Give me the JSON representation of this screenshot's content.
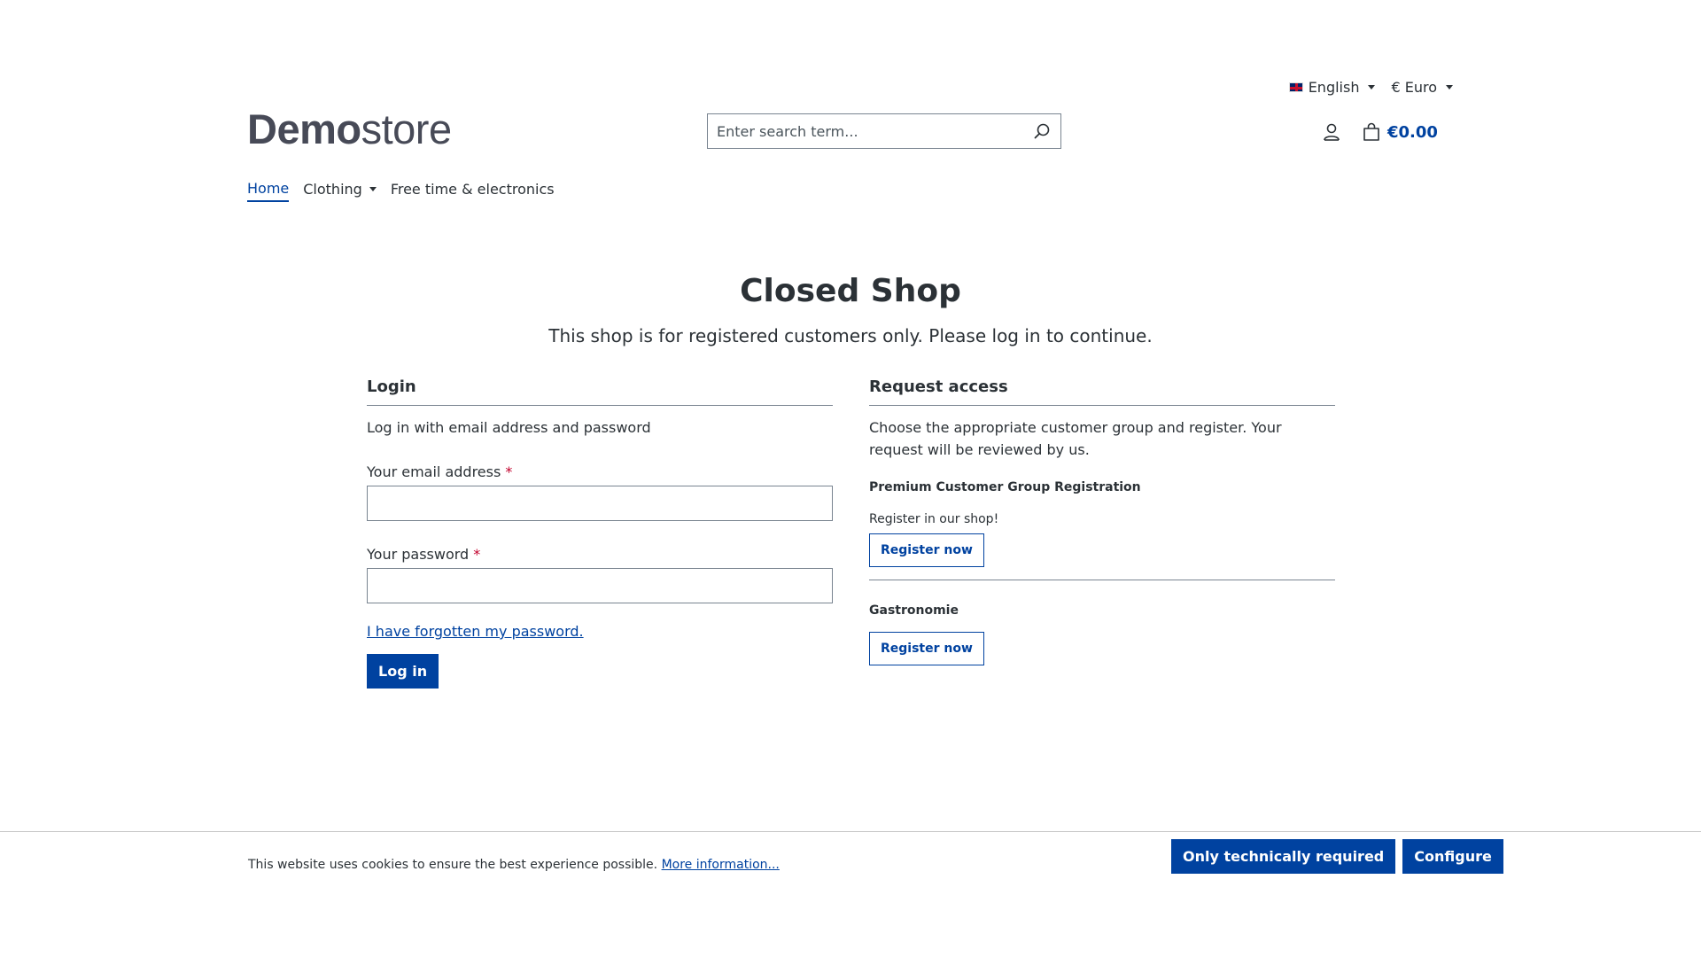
{
  "top_bar": {
    "language": {
      "label": "English",
      "icon": "uk-flag-icon"
    },
    "currency": {
      "label": "€ Euro"
    }
  },
  "header": {
    "logo_bold": "Demo",
    "logo_light": "store",
    "search_placeholder": "Enter search term...",
    "search_icon": "search-icon",
    "account_icon": "user-icon",
    "cart_icon": "shopping-bag-icon",
    "cart_total": "€0.00"
  },
  "nav": {
    "items": [
      {
        "label": "Home",
        "active": true
      },
      {
        "label": "Clothing",
        "has_dropdown": true
      },
      {
        "label": "Free time & electronics"
      }
    ]
  },
  "main": {
    "title": "Closed Shop",
    "subtitle": "This shop is for registered customers only. Please log in to continue."
  },
  "login": {
    "heading": "Login",
    "lead": "Log in with email address and password",
    "email_label": "Your email address",
    "password_label": "Your password",
    "required_marker": "*",
    "forgot_link": "I have forgotten my password.",
    "submit_label": "Log in"
  },
  "request_access": {
    "heading": "Request access",
    "lead": "Choose the appropriate customer group and register. Your request will be reviewed by us.",
    "groups": [
      {
        "title": "Premium Customer Group Registration",
        "description": "Register in our shop!",
        "button": "Register now"
      },
      {
        "title": "Gastronomie",
        "description": "",
        "button": "Register now"
      }
    ]
  },
  "cookie_bar": {
    "text": "This website uses cookies to ensure the best experience possible.",
    "link": "More information...",
    "btn_technical": "Only technically required",
    "btn_configure": "Configure"
  },
  "colors": {
    "brand": "#0042a0",
    "text": "#2b3136",
    "required": "#c2002c"
  }
}
